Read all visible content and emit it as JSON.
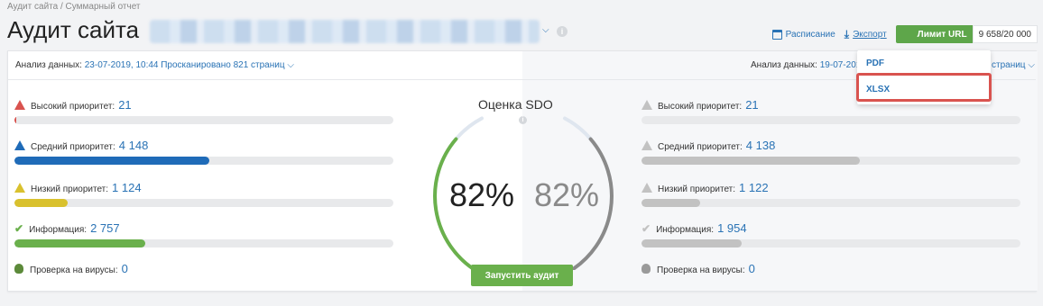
{
  "breadcrumb": "Аудит сайта / Суммарный отчет",
  "title": "Аудит сайта",
  "header": {
    "schedule_label": "Расписание",
    "export_label": "Экспорт",
    "limit_label": "Лимит URL",
    "limit_value": "9 658/20 000"
  },
  "filters": {
    "label": "Анализ данных:",
    "left_value": "23-07-2019, 10:44 Просканировано 821 страниц",
    "right_value_start": "19-07-201",
    "right_value_end": "страниц"
  },
  "export_menu": {
    "items": [
      "PDF",
      "XLSX"
    ]
  },
  "left_metrics": [
    {
      "label": "Высокий приоритет:",
      "value": "21",
      "fill": 0.005,
      "color": "#d9534f",
      "icon": "warning-red-icon"
    },
    {
      "label": "Средний приоритет:",
      "value": "4 148",
      "fill": 0.515,
      "color": "#1f6bb8",
      "icon": "warning-blue-icon"
    },
    {
      "label": "Низкий приоритет:",
      "value": "1 124",
      "fill": 0.14,
      "color": "#d9c12e",
      "icon": "warning-yellow-icon"
    },
    {
      "label": "Информация:",
      "value": "2 757",
      "fill": 0.345,
      "color": "#6ab04c",
      "icon": "check-icon"
    },
    {
      "label": "Проверка на вирусы:",
      "value": "0",
      "fill": null,
      "color": "#5c8a3a",
      "icon": "bug-icon"
    }
  ],
  "right_metrics": [
    {
      "label": "Высокий приоритет:",
      "value": "21",
      "fill": 0.0,
      "color": "#c2c2c2",
      "icon": "warning-gray-icon"
    },
    {
      "label": "Средний приоритет:",
      "value": "4 138",
      "fill": 0.575,
      "color": "#c2c2c2",
      "icon": "warning-gray-icon"
    },
    {
      "label": "Низкий приоритет:",
      "value": "1 122",
      "fill": 0.155,
      "color": "#c2c2c2",
      "icon": "warning-gray-icon"
    },
    {
      "label": "Информация:",
      "value": "1 954",
      "fill": 0.265,
      "color": "#c2c2c2",
      "icon": "check-gray-icon"
    },
    {
      "label": "Проверка на вирусы:",
      "value": "0",
      "fill": null,
      "color": "#9a9a9a",
      "icon": "bug-gray-icon"
    }
  ],
  "gauge": {
    "title": "Оценка SDO",
    "left_percent": "82%",
    "right_percent": "82%",
    "left_score": 0.82,
    "right_score": 0.82,
    "left_color": "#6ab04c",
    "right_color": "#8a8a8a"
  },
  "run_button": "Запустить аудит"
}
